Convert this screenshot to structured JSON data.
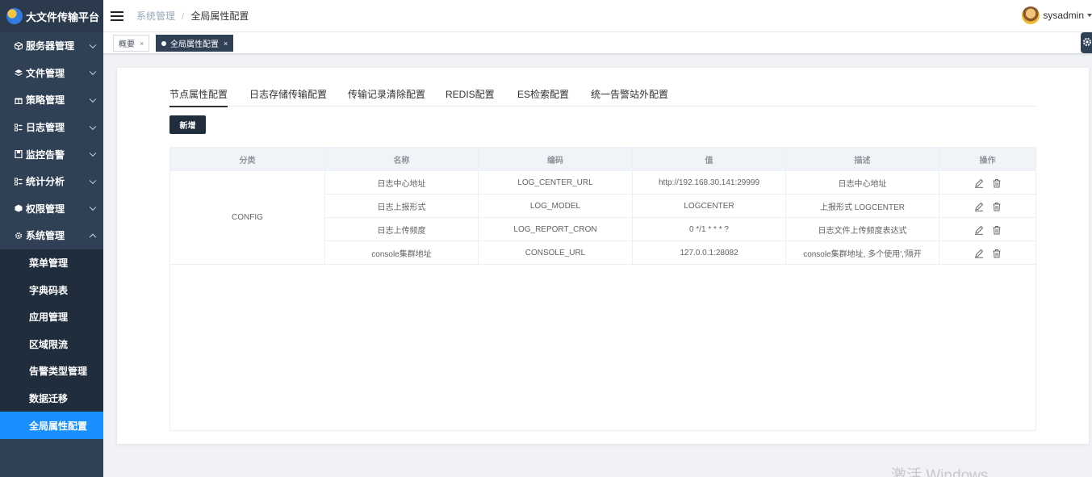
{
  "app": {
    "title": "大文件传输平台"
  },
  "sidebar": {
    "menus": [
      {
        "label": "服务器管理",
        "icon": "cube-icon"
      },
      {
        "label": "文件管理",
        "icon": "layers-icon"
      },
      {
        "label": "策略管理",
        "icon": "gift-icon"
      },
      {
        "label": "日志管理",
        "icon": "list-icon"
      },
      {
        "label": "监控告警",
        "icon": "save-icon"
      },
      {
        "label": "统计分析",
        "icon": "chart-icon"
      },
      {
        "label": "权限管理",
        "icon": "shield-icon"
      },
      {
        "label": "系统管理",
        "icon": "gear-icon"
      }
    ],
    "system_children": [
      {
        "label": "菜单管理"
      },
      {
        "label": "字典码表"
      },
      {
        "label": "应用管理"
      },
      {
        "label": "区域限流"
      },
      {
        "label": "告警类型管理"
      },
      {
        "label": "数据迁移"
      },
      {
        "label": "全局属性配置"
      }
    ]
  },
  "header": {
    "breadcrumb": [
      "系统管理",
      "全局属性配置"
    ],
    "user": "sysadmin"
  },
  "tags": [
    {
      "label": "概要"
    },
    {
      "label": "全局属性配置"
    }
  ],
  "config_tabs": [
    {
      "label": "节点属性配置"
    },
    {
      "label": "日志存储传输配置"
    },
    {
      "label": "传输记录清除配置"
    },
    {
      "label": "REDIS配置"
    },
    {
      "label": "ES检索配置"
    },
    {
      "label": "统一告警站外配置"
    }
  ],
  "toolbar": {
    "add_label": "新增"
  },
  "table": {
    "columns": [
      "分类",
      "名称",
      "编码",
      "值",
      "描述",
      "操作"
    ],
    "category": "CONFIG",
    "rows": [
      {
        "name": "日志中心地址",
        "code": "LOG_CENTER_URL",
        "value": "http://192.168.30.141:29999",
        "desc": "日志中心地址"
      },
      {
        "name": "日志上报形式",
        "code": "LOG_MODEL",
        "value": "LOGCENTER",
        "desc": "上报形式 LOGCENTER"
      },
      {
        "name": "日志上传频度",
        "code": "LOG_REPORT_CRON",
        "value": "0 */1 * * * ?",
        "desc": "日志文件上传频度表达式"
      },
      {
        "name": "console集群地址",
        "code": "CONSOLE_URL",
        "value": "127.0.0.1:28082",
        "desc": "console集群地址, 多个使用','隔开"
      }
    ]
  },
  "watermark": "激活 Windows"
}
